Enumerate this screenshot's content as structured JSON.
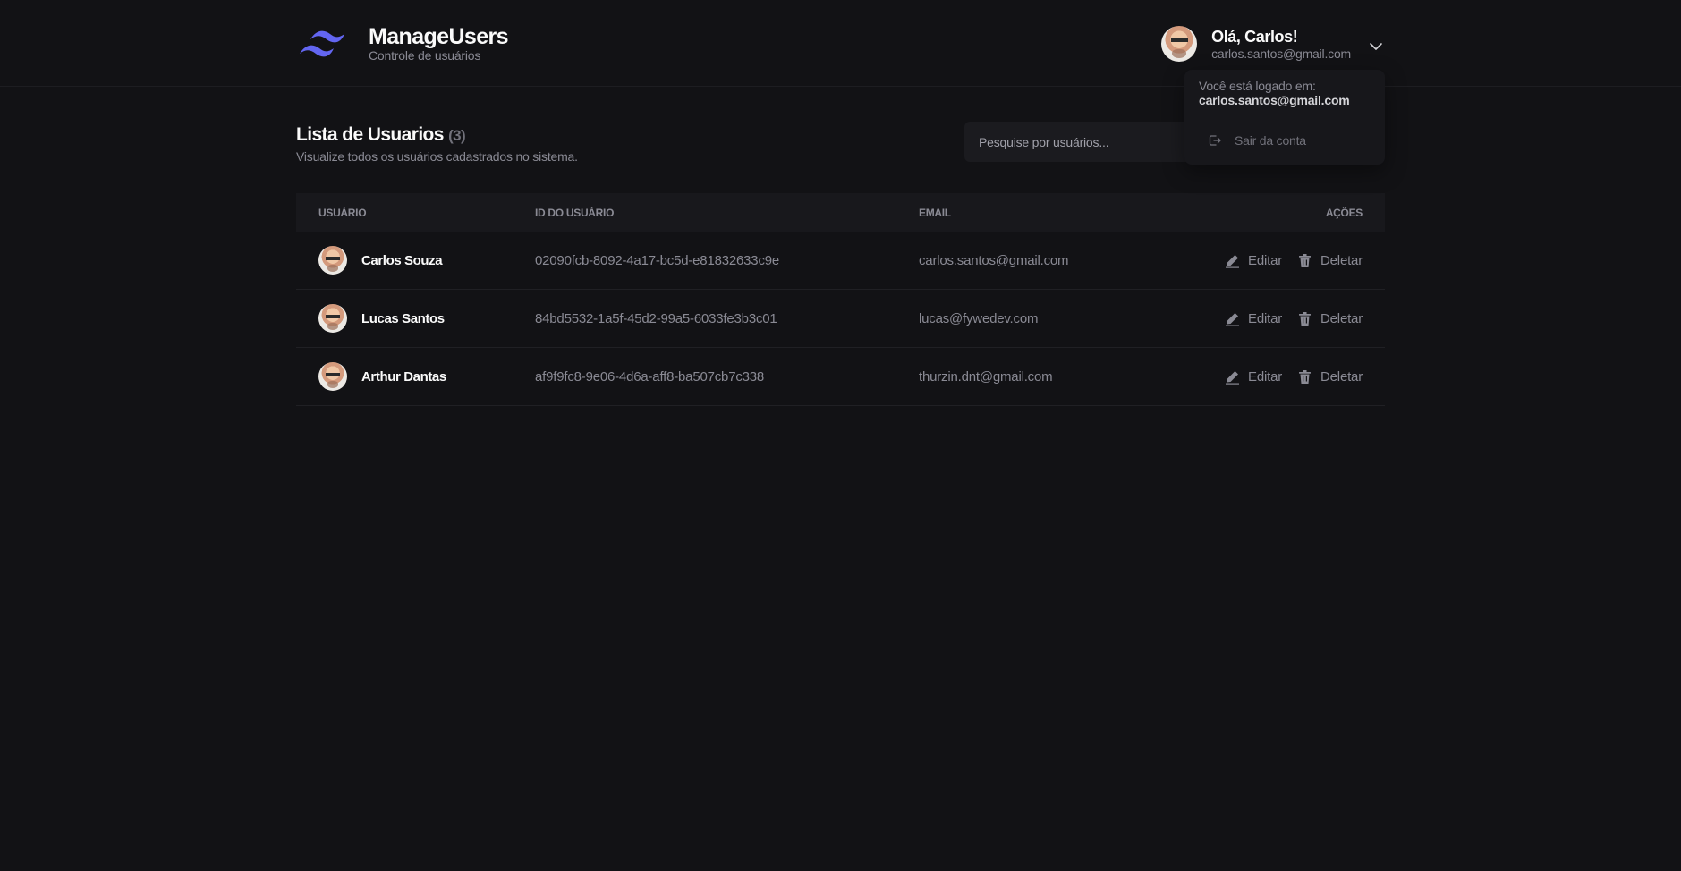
{
  "brand": {
    "title": "ManageUsers",
    "subtitle": "Controle de usuários",
    "logo_icon": "wave-logo-icon",
    "accent_color": "#6366f1"
  },
  "user_menu": {
    "greeting": "Olá, Carlos!",
    "email": "carlos.santos@gmail.com",
    "dropdown": {
      "logged_label": "Você está logado em:",
      "logged_email": "carlos.santos@gmail.com",
      "logout_label": "Sair da conta"
    }
  },
  "list": {
    "title": "Lista de Usuarios",
    "count": "(3)",
    "subtitle": "Visualize todos os usuários cadastrados no sistema.",
    "search_placeholder": "Pesquise por usuários..."
  },
  "table": {
    "headers": {
      "user": "USUÁRIO",
      "id": "ID DO USUÁRIO",
      "email": "EMAIL",
      "actions": "AÇÕES"
    },
    "edit_label": "Editar",
    "delete_label": "Deletar",
    "rows": [
      {
        "name": "Carlos Souza",
        "id": "02090fcb-8092-4a17-bc5d-e81832633c9e",
        "email": "carlos.santos@gmail.com"
      },
      {
        "name": "Lucas Santos",
        "id": "84bd5532-1a5f-45d2-99a5-6033fe3b3c01",
        "email": "lucas@fywedev.com"
      },
      {
        "name": "Arthur Dantas",
        "id": "af9f9fc8-9e06-4d6a-aff8-ba507cb7c338",
        "email": "thurzin.dnt@gmail.com"
      }
    ]
  }
}
